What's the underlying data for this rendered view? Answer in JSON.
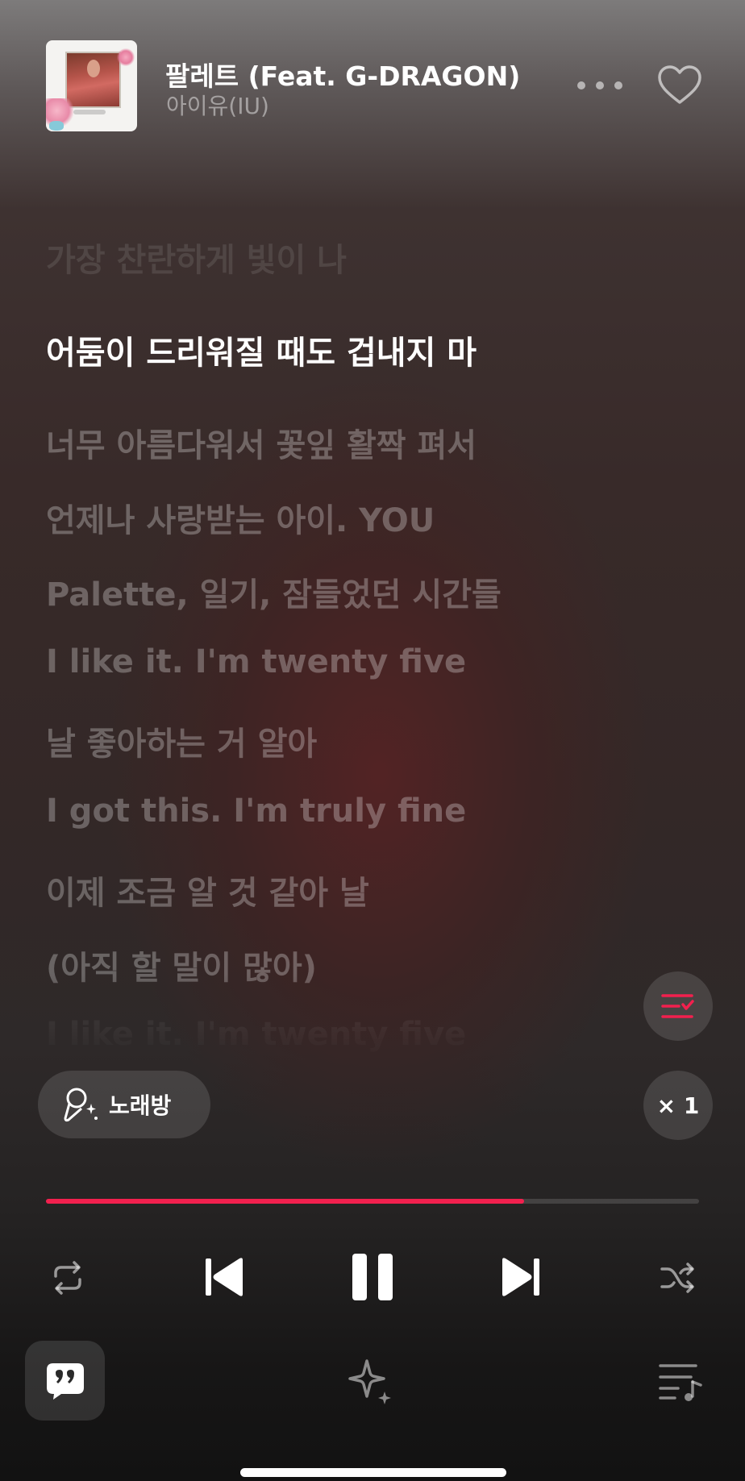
{
  "now_playing": {
    "title": "팔레트 (Feat. G-DRAGON)",
    "artist": "아이유(IU)"
  },
  "header": {
    "more_icon": "ellipsis-icon",
    "like_icon": "heart-outline-icon"
  },
  "lyrics": {
    "lines": [
      "가장 찬란하게 빛이 나",
      "어둠이 드리워질 때도 겁내지 마",
      "너무 아름다워서 꽃잎 활짝 펴서",
      "언제나 사랑받는 아이. YOU",
      "Palette, 일기, 잠들었던 시간들",
      "I like it. I'm twenty five",
      "날 좋아하는 거 알아",
      "I got this. I'm truly fine",
      "이제 조금 알 것 같아 날",
      "(아직 할 말이 많아)",
      "I like it. I'm twenty five"
    ],
    "current_index": 1
  },
  "karaoke": {
    "label": "노래방",
    "icon": "microphone-sparkle-icon"
  },
  "playback_speed": {
    "label": "× 1"
  },
  "progress": {
    "fraction": 0.732
  },
  "controls": {
    "repeat_icon": "repeat-icon",
    "prev_icon": "skip-previous-icon",
    "play_state_icon": "pause-icon",
    "next_icon": "skip-next-icon",
    "shuffle_icon": "shuffle-icon"
  },
  "bottom_tabs": {
    "lyrics_icon": "quote-bubble-icon",
    "discover_icon": "sparkle-icon",
    "queue_icon": "playlist-icon"
  },
  "colors": {
    "accent": "#f2204e",
    "text_primary": "#ffffff"
  }
}
